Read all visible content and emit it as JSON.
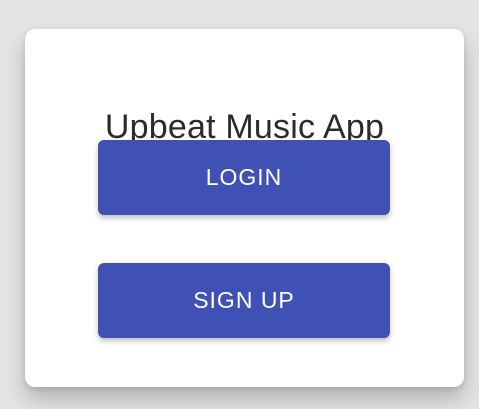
{
  "app": {
    "title": "Upbeat Music App"
  },
  "actions": {
    "login_label": "LOGIN",
    "signup_label": "SIGN UP"
  },
  "colors": {
    "primary": "#3f51b5",
    "background": "#e4e4e4",
    "card": "#ffffff",
    "title_text": "#2b2b2b"
  }
}
